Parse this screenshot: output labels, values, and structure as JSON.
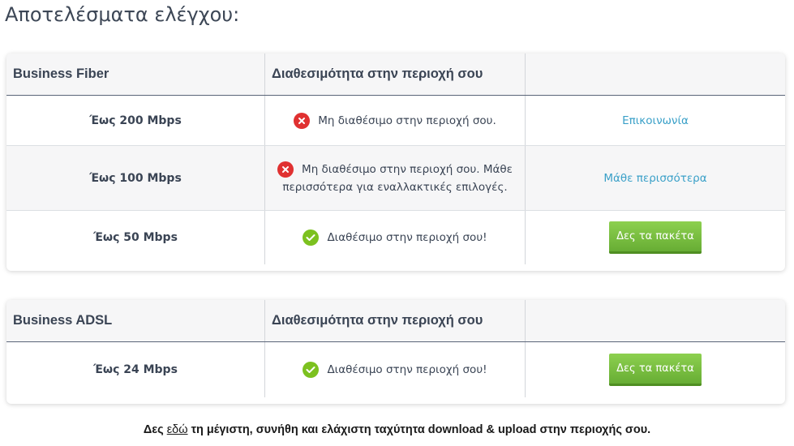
{
  "title": "Αποτελέσματα ελέγχου:",
  "tables": [
    {
      "product": "Business Fiber",
      "availability_header": "Διαθεσιμότητα στην περιοχή σου",
      "rows": [
        {
          "speed": "Έως 200 Mbps",
          "status_icon": "x-circle-icon",
          "status": "Μη διαθέσιμο στην περιοχή σου.",
          "action": "Επικοινωνία"
        },
        {
          "speed": "Έως 100 Mbps",
          "status_icon": "x-circle-icon",
          "status_line1": "Μη διαθέσιμο στην περιοχή σου. Μάθε",
          "status_line2": "περισσότερα για εναλλακτικές επιλογές.",
          "action": "Μάθε περισσότερα"
        },
        {
          "speed": "Έως 50 Mbps",
          "status_icon": "check-circle-icon",
          "status": "Διαθέσιμο στην περιοχή σου!",
          "action": "Δες τα πακέτα"
        }
      ]
    },
    {
      "product": "Business ADSL",
      "availability_header": "Διαθεσιμότητα στην περιοχή σου",
      "rows": [
        {
          "speed": "Έως 24 Mbps",
          "status_icon": "check-circle-icon",
          "status": "Διαθέσιμο στην περιοχή σου!",
          "action": "Δες τα πακέτα"
        }
      ]
    }
  ],
  "footer": {
    "prefix": "Δες ",
    "link": "εδώ",
    "suffix": " τη μέγιστη, συνήθη και ελάχιστη ταχύτητα download & upload στην περιοχής σου."
  },
  "colors": {
    "error": "#e03131",
    "success": "#7cc11f",
    "link": "#3aa0c8",
    "button": "#6fb53a"
  }
}
